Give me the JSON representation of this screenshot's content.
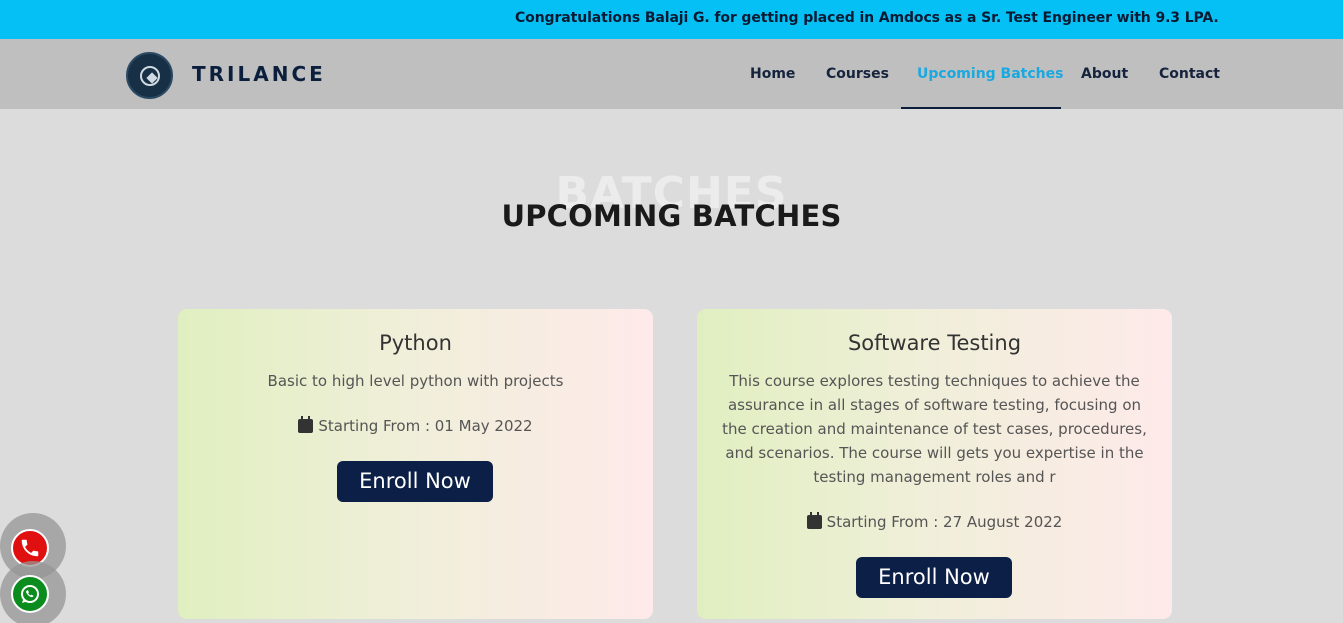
{
  "announcement": "Congratulations Balaji G. for getting placed in Amdocs as a Sr. Test Engineer with 9.3 LPA.",
  "brand": {
    "name": "TRILANCE",
    "logo_text": "TRILANCE"
  },
  "nav": {
    "items": [
      {
        "label": "Home"
      },
      {
        "label": "Courses"
      },
      {
        "label": "Upcoming Batches"
      },
      {
        "label": "About"
      },
      {
        "label": "Contact"
      }
    ],
    "active": "Upcoming Batches"
  },
  "section": {
    "background_word": "BATCHES",
    "title": "UPCOMING BATCHES"
  },
  "batches": [
    {
      "title": "Python",
      "description": "Basic to high level python with projects",
      "date": "Starting From : 01 May 2022",
      "button": "Enroll Now"
    },
    {
      "title": "Software Testing",
      "description": "This course explores testing techniques to achieve the assurance in all stages of software testing, focusing on the creation and maintenance of test cases, procedures, and scenarios. The course will gets you expertise in the testing management roles and r",
      "date": "Starting From : 27 August 2022",
      "button": "Enroll Now"
    }
  ],
  "floating": {
    "phone_icon": "phone-icon",
    "whatsapp_icon": "whatsapp-icon"
  },
  "colors": {
    "announcement_bg": "#04c0f5",
    "navbar_bg": "#bfbfbf",
    "active_nav": "#1aa8e0",
    "button_bg": "#0b1f47",
    "phone": "#e01010",
    "whatsapp": "#0a8c1e"
  }
}
